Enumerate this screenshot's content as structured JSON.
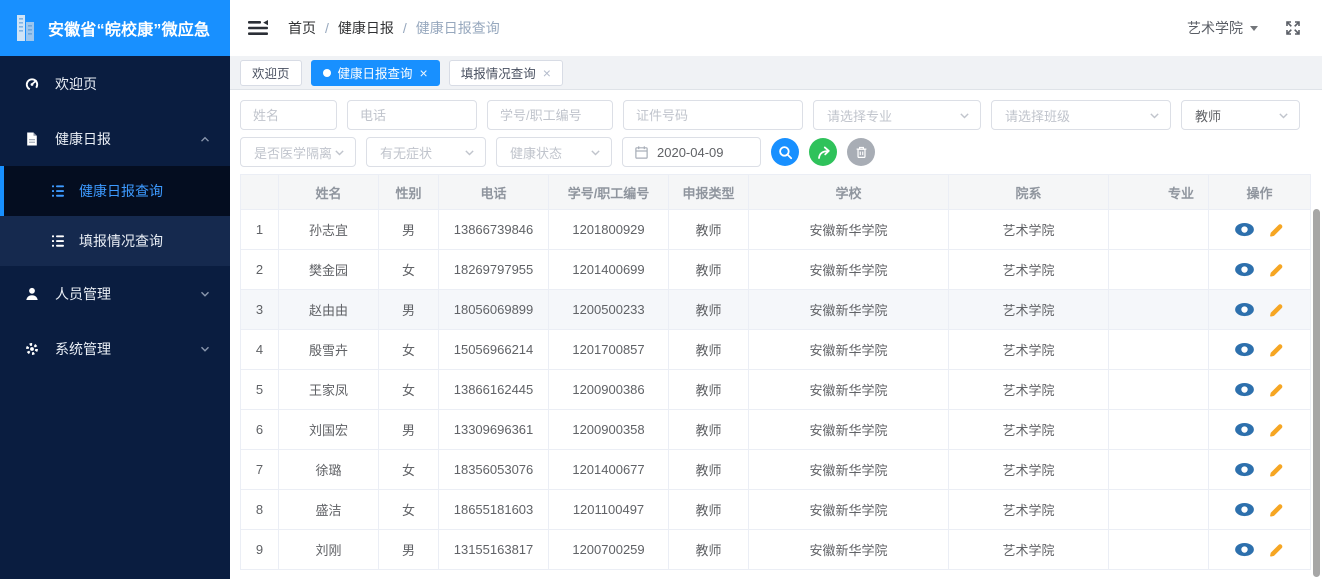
{
  "colors": {
    "accent": "#1890ff",
    "sidebar_bg": "#0a1d40",
    "sidebar_submenu_bg": "#15294e",
    "sidebar_active_bg": "#040d20",
    "sidebar_active_text": "#3d9aff",
    "export_green": "#2fc25b",
    "delete_gray": "#a8adb5",
    "view_icon_blue": "#2d70ad",
    "edit_icon_orange": "#f6a623",
    "page_bg": "#f0f2f5"
  },
  "icons": {
    "search": "magnifier",
    "export": "curved-arrow-up-right",
    "delete": "trash-can",
    "view": "eye",
    "edit": "pencil",
    "fullscreen": "expand-arrows",
    "collapse": "menu-fold",
    "date": "calendar",
    "logo": "building"
  },
  "app": {
    "title": "安徽省“皖校康”微应急"
  },
  "header": {
    "breadcrumb": [
      "首页",
      "健康日报",
      "健康日报查询"
    ],
    "org": "艺术学院"
  },
  "tabs": [
    {
      "id": "welcome",
      "label": "欢迎页",
      "active": false,
      "closable": false
    },
    {
      "id": "daily-query",
      "label": "健康日报查询",
      "active": true,
      "closable": true
    },
    {
      "id": "report-status",
      "label": "填报情况查询",
      "active": false,
      "closable": true
    }
  ],
  "sidebar": {
    "items": [
      {
        "id": "welcome",
        "icon": "dashboard-icon",
        "label": "欢迎页",
        "type": "item"
      },
      {
        "id": "daily-report",
        "icon": "document-icon",
        "label": "健康日报",
        "type": "group",
        "expanded": true,
        "children": [
          {
            "id": "daily-query",
            "icon": "list-icon",
            "label": "健康日报查询",
            "active": true
          },
          {
            "id": "report-status",
            "icon": "list-icon",
            "label": "填报情况查询",
            "active": false
          }
        ]
      },
      {
        "id": "personnel",
        "icon": "user-icon",
        "label": "人员管理",
        "type": "group",
        "expanded": false
      },
      {
        "id": "system",
        "icon": "gear-icon",
        "label": "系统管理",
        "type": "group",
        "expanded": false
      }
    ]
  },
  "filters": {
    "row1": [
      {
        "id": "name",
        "type": "input",
        "placeholder": "姓名",
        "value": ""
      },
      {
        "id": "phone",
        "type": "input",
        "placeholder": "电话",
        "value": ""
      },
      {
        "id": "staff-id",
        "type": "input",
        "placeholder": "学号/职工编号",
        "value": ""
      },
      {
        "id": "id-number",
        "type": "input",
        "placeholder": "证件号码",
        "value": ""
      },
      {
        "id": "major",
        "type": "select",
        "placeholder": "请选择专业",
        "value": ""
      },
      {
        "id": "class",
        "type": "select",
        "placeholder": "请选择班级",
        "value": ""
      },
      {
        "id": "role",
        "type": "select",
        "placeholder": "",
        "value": "教师"
      }
    ],
    "row2": [
      {
        "id": "medical-isolation",
        "type": "select",
        "placeholder": "是否医学隔离",
        "value": ""
      },
      {
        "id": "symptoms",
        "type": "select",
        "placeholder": "有无症状",
        "value": ""
      },
      {
        "id": "health-status",
        "type": "select",
        "placeholder": "健康状态",
        "value": ""
      },
      {
        "id": "date",
        "type": "date",
        "value": "2020-04-09"
      }
    ]
  },
  "table": {
    "columns": [
      {
        "key": "index",
        "label": ""
      },
      {
        "key": "name",
        "label": "姓名"
      },
      {
        "key": "gender",
        "label": "性别"
      },
      {
        "key": "phone",
        "label": "电话"
      },
      {
        "key": "staff_id",
        "label": "学号/职工编号"
      },
      {
        "key": "report_type",
        "label": "申报类型"
      },
      {
        "key": "school",
        "label": "学校"
      },
      {
        "key": "department",
        "label": "院系"
      },
      {
        "key": "major",
        "label": "专业"
      },
      {
        "key": "actions",
        "label": "操作"
      }
    ],
    "highlighted_row": 3,
    "rows": [
      {
        "index": 1,
        "name": "孙志宜",
        "gender": "男",
        "phone": "13866739846",
        "staff_id": "1201800929",
        "report_type": "教师",
        "school": "安徽新华学院",
        "department": "艺术学院",
        "major": ""
      },
      {
        "index": 2,
        "name": "樊金园",
        "gender": "女",
        "phone": "18269797955",
        "staff_id": "1201400699",
        "report_type": "教师",
        "school": "安徽新华学院",
        "department": "艺术学院",
        "major": ""
      },
      {
        "index": 3,
        "name": "赵由由",
        "gender": "男",
        "phone": "18056069899",
        "staff_id": "1200500233",
        "report_type": "教师",
        "school": "安徽新华学院",
        "department": "艺术学院",
        "major": ""
      },
      {
        "index": 4,
        "name": "殷雪卉",
        "gender": "女",
        "phone": "15056966214",
        "staff_id": "1201700857",
        "report_type": "教师",
        "school": "安徽新华学院",
        "department": "艺术学院",
        "major": ""
      },
      {
        "index": 5,
        "name": "王家凤",
        "gender": "女",
        "phone": "13866162445",
        "staff_id": "1200900386",
        "report_type": "教师",
        "school": "安徽新华学院",
        "department": "艺术学院",
        "major": ""
      },
      {
        "index": 6,
        "name": "刘国宏",
        "gender": "男",
        "phone": "13309696361",
        "staff_id": "1200900358",
        "report_type": "教师",
        "school": "安徽新华学院",
        "department": "艺术学院",
        "major": ""
      },
      {
        "index": 7,
        "name": "徐璐",
        "gender": "女",
        "phone": "18356053076",
        "staff_id": "1201400677",
        "report_type": "教师",
        "school": "安徽新华学院",
        "department": "艺术学院",
        "major": ""
      },
      {
        "index": 8,
        "name": "盛洁",
        "gender": "女",
        "phone": "18655181603",
        "staff_id": "1201100497",
        "report_type": "教师",
        "school": "安徽新华学院",
        "department": "艺术学院",
        "major": ""
      },
      {
        "index": 9,
        "name": "刘刚",
        "gender": "男",
        "phone": "13155163817",
        "staff_id": "1200700259",
        "report_type": "教师",
        "school": "安徽新华学院",
        "department": "艺术学院",
        "major": ""
      }
    ]
  }
}
